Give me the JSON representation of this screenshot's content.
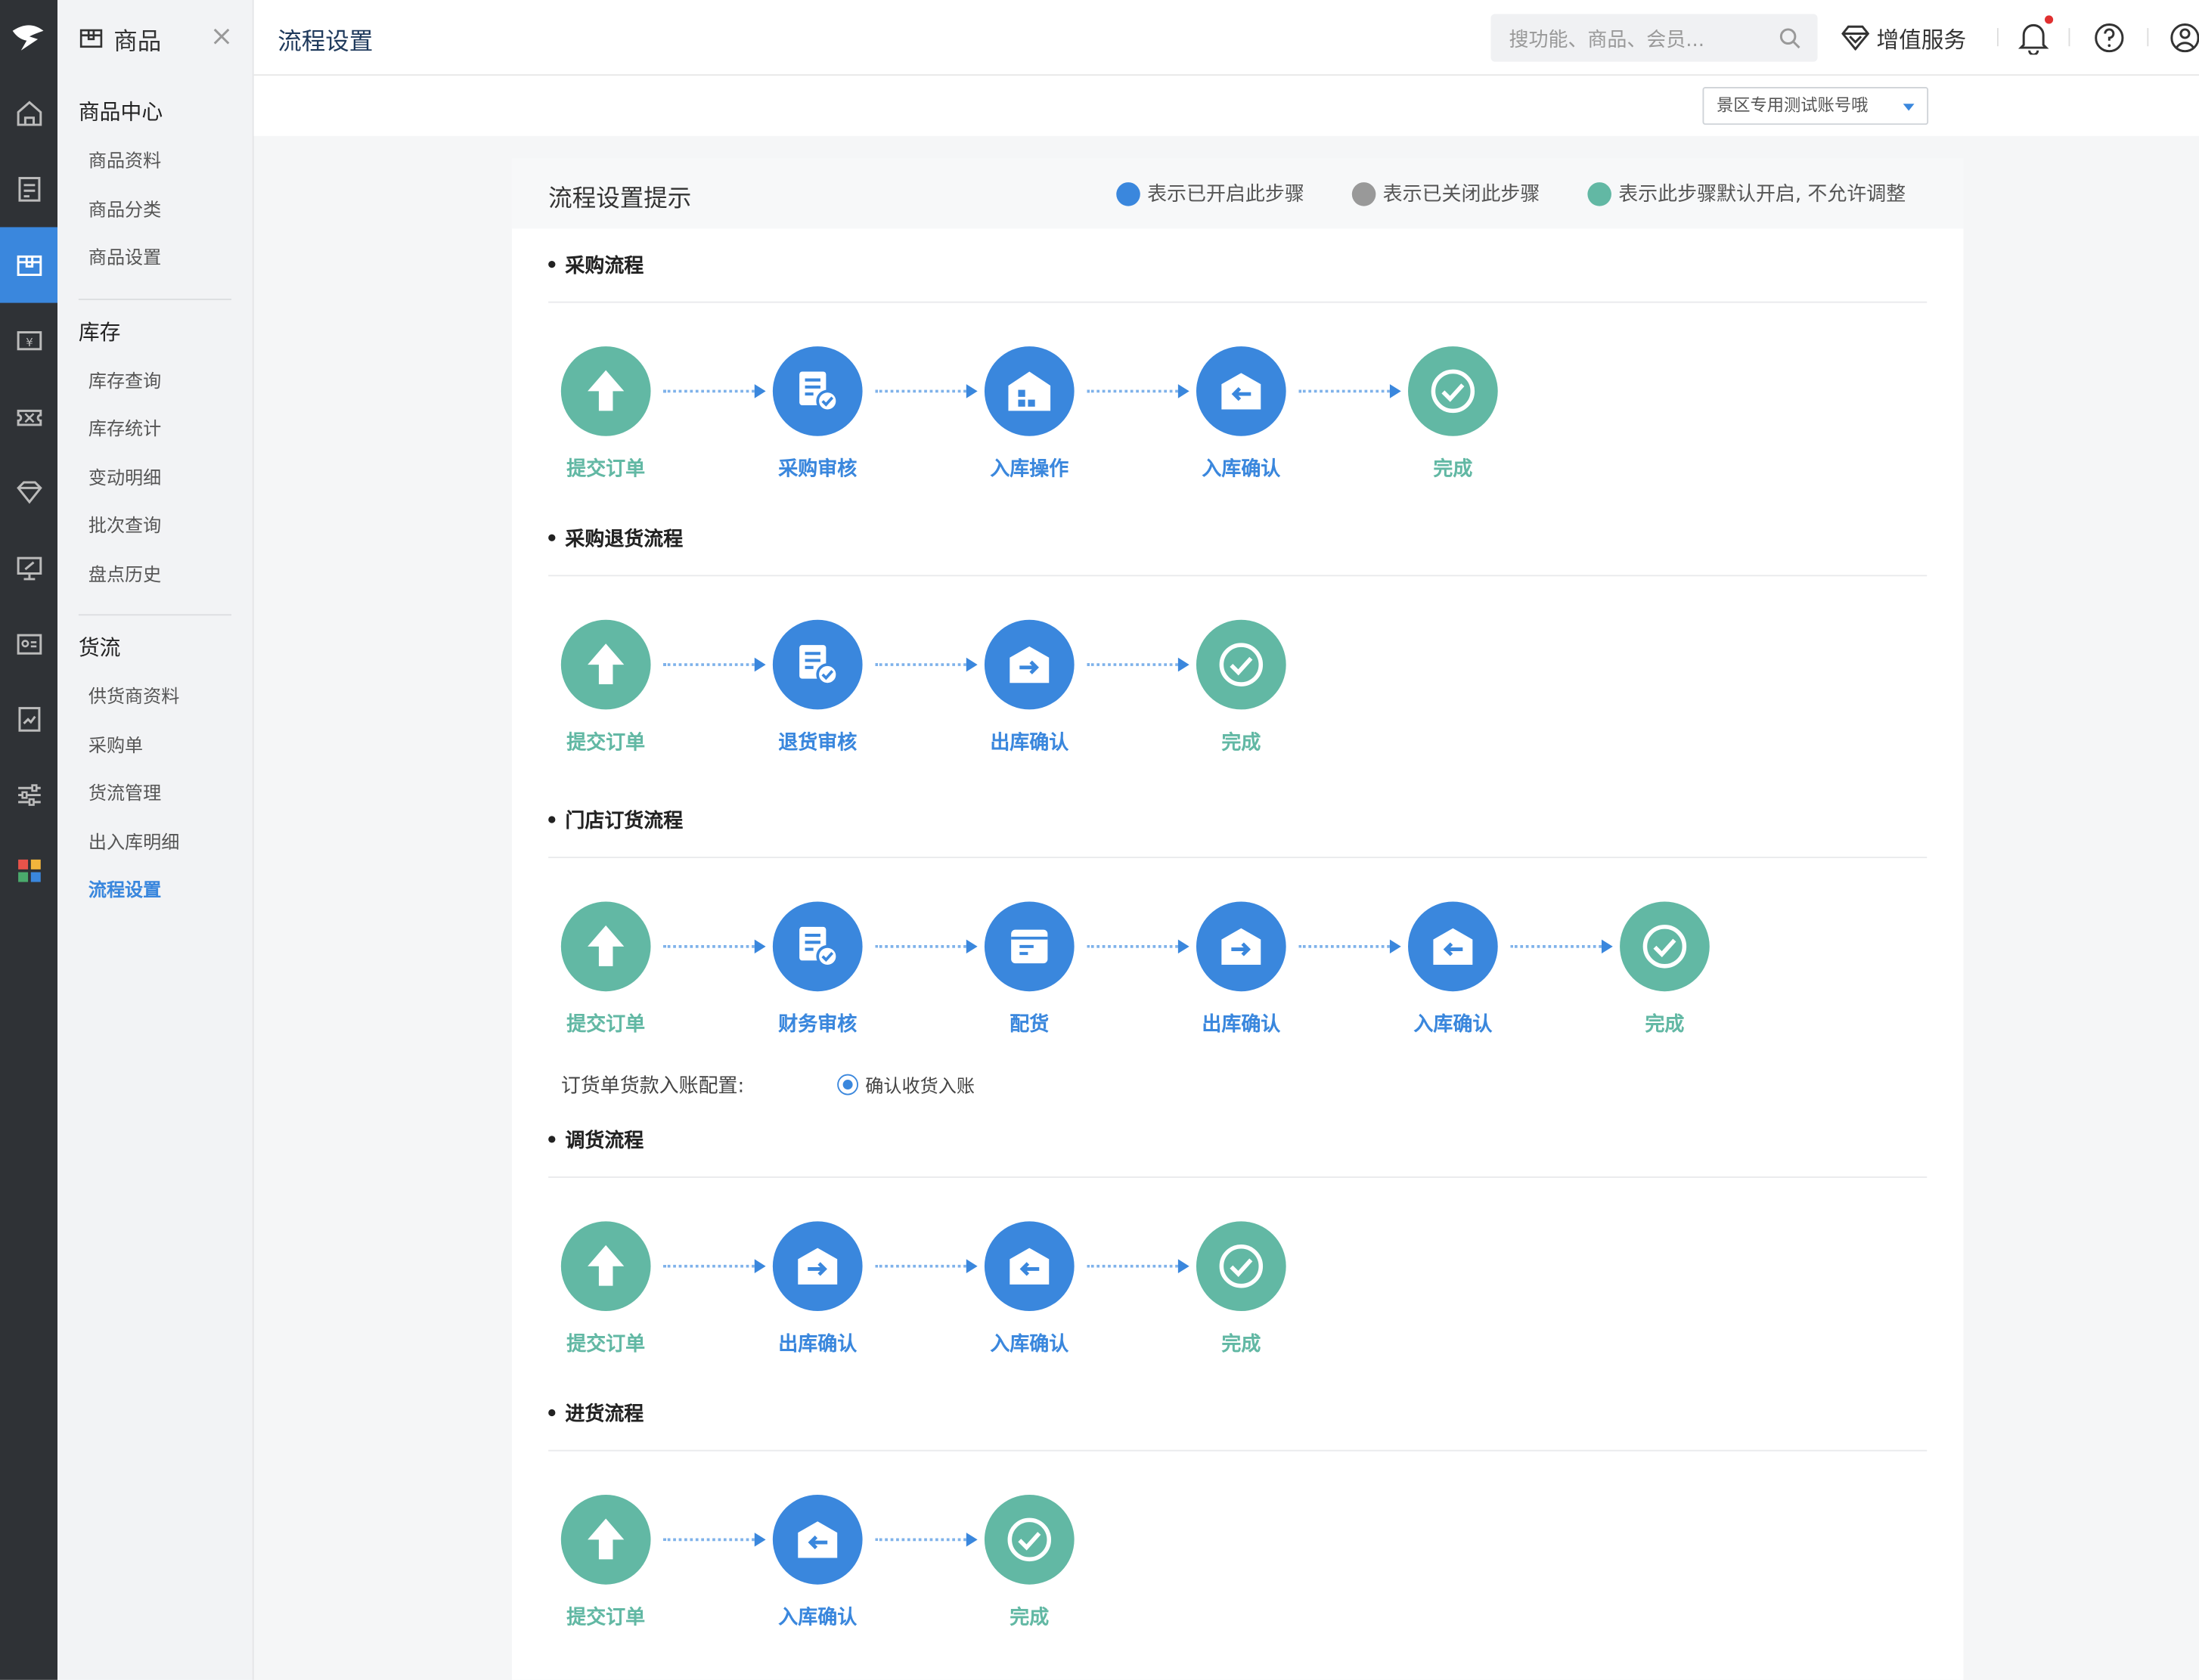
{
  "module": {
    "title": "商品"
  },
  "header": {
    "page_title": "流程设置",
    "search_placeholder": "搜功能、商品、会员...",
    "value_service": "增值服务"
  },
  "account": {
    "selected": "景区专用测试账号哦"
  },
  "sidebar": {
    "groups": [
      {
        "title": "商品中心",
        "items": [
          "商品资料",
          "商品分类",
          "商品设置"
        ]
      },
      {
        "title": "库存",
        "items": [
          "库存查询",
          "库存统计",
          "变动明细",
          "批次查询",
          "盘点历史"
        ]
      },
      {
        "title": "货流",
        "items": [
          "供货商资料",
          "采购单",
          "货流管理",
          "出入库明细",
          "流程设置"
        ]
      }
    ],
    "active_item": "流程设置"
  },
  "rail_icons": [
    "logo-icon",
    "home-icon",
    "report-icon",
    "goods-icon",
    "cash-icon",
    "coupon-icon",
    "diamond-icon",
    "monitor-icon",
    "member-card-icon",
    "chart-doc-icon",
    "settings-slider-icon",
    "apps-grid-icon"
  ],
  "panel": {
    "title": "流程设置提示",
    "legend": [
      {
        "label": "表示已开启此步骤",
        "color": "#3a87dd"
      },
      {
        "label": "表示已关闭此步骤",
        "color": "#999999"
      },
      {
        "label": "表示此步骤默认开启, 不允许调整",
        "color": "#62b8a4"
      }
    ]
  },
  "flows": [
    {
      "title": "采购流程",
      "steps": [
        {
          "label": "提交订单",
          "state": "default",
          "icon": "upload-arrow-icon"
        },
        {
          "label": "采购审核",
          "state": "enabled",
          "icon": "doc-check-icon"
        },
        {
          "label": "入库操作",
          "state": "enabled",
          "icon": "warehouse-icon"
        },
        {
          "label": "入库确认",
          "state": "enabled",
          "icon": "box-in-icon"
        },
        {
          "label": "完成",
          "state": "default",
          "icon": "check-circle-icon"
        }
      ]
    },
    {
      "title": "采购退货流程",
      "steps": [
        {
          "label": "提交订单",
          "state": "default",
          "icon": "upload-arrow-icon"
        },
        {
          "label": "退货审核",
          "state": "enabled",
          "icon": "doc-check-icon"
        },
        {
          "label": "出库确认",
          "state": "enabled",
          "icon": "box-out-icon"
        },
        {
          "label": "完成",
          "state": "default",
          "icon": "check-circle-icon"
        }
      ]
    },
    {
      "title": "门店订货流程",
      "steps": [
        {
          "label": "提交订单",
          "state": "default",
          "icon": "upload-arrow-icon"
        },
        {
          "label": "财务审核",
          "state": "enabled",
          "icon": "doc-check-icon"
        },
        {
          "label": "配货",
          "state": "enabled",
          "icon": "package-icon"
        },
        {
          "label": "出库确认",
          "state": "enabled",
          "icon": "box-out-icon"
        },
        {
          "label": "入库确认",
          "state": "enabled",
          "icon": "box-in-icon"
        },
        {
          "label": "完成",
          "state": "default",
          "icon": "check-circle-icon"
        }
      ]
    },
    {
      "title": "调货流程",
      "steps": [
        {
          "label": "提交订单",
          "state": "default",
          "icon": "upload-arrow-icon"
        },
        {
          "label": "出库确认",
          "state": "enabled",
          "icon": "box-out-icon"
        },
        {
          "label": "入库确认",
          "state": "enabled",
          "icon": "box-in-icon"
        },
        {
          "label": "完成",
          "state": "default",
          "icon": "check-circle-icon"
        }
      ]
    },
    {
      "title": "进货流程",
      "steps": [
        {
          "label": "提交订单",
          "state": "default",
          "icon": "upload-arrow-icon"
        },
        {
          "label": "入库确认",
          "state": "enabled",
          "icon": "box-in-icon"
        },
        {
          "label": "完成",
          "state": "default",
          "icon": "check-circle-icon"
        }
      ]
    }
  ],
  "order_config": {
    "label": "订货单货款入账配置:",
    "option": "确认收货入账"
  }
}
